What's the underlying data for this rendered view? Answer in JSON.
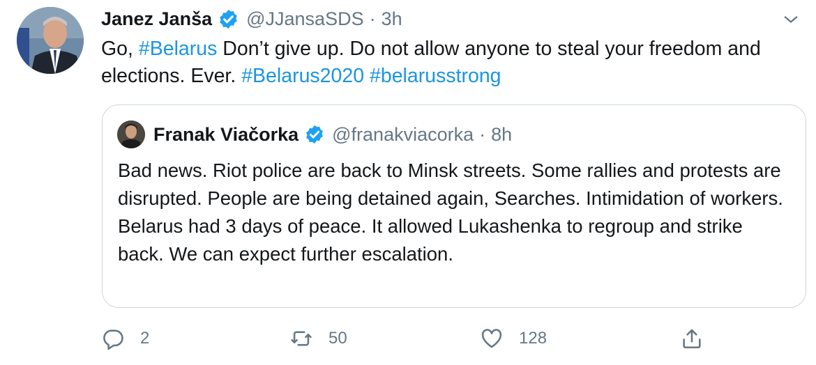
{
  "tweet": {
    "author": {
      "display_name": "Janez Janša",
      "handle": "@JJansaSDS",
      "separator": "·",
      "time": "3h",
      "verified_icon": "verified-badge-icon"
    },
    "text": {
      "part1": "Go, ",
      "hashtag1": "#Belarus",
      "part2": " Don’t give up. Do not allow anyone to steal your freedom and elections. Ever. ",
      "hashtag2": "#Belarus2020",
      "space": " ",
      "hashtag3": "#belarusstrong"
    },
    "menu_icon": "chevron-down-icon"
  },
  "quoted_tweet": {
    "author": {
      "display_name": "Franak Viačorka",
      "handle": "@franakviacorka",
      "separator": "·",
      "time": "8h",
      "verified_icon": "verified-badge-icon"
    },
    "text": "Bad news. Riot police are back to Minsk streets. Some rallies and protests are disrupted. People are being detained again, Searches. Intimidation of workers. Belarus had 3 days of peace. It allowed Lukashenka to regroup and strike back. We can expect further escalation."
  },
  "actions": {
    "reply": {
      "icon": "reply-icon",
      "count": "2"
    },
    "retweet": {
      "icon": "retweet-icon",
      "count": "50"
    },
    "like": {
      "icon": "heart-icon",
      "count": "128"
    },
    "share": {
      "icon": "share-icon"
    }
  },
  "colors": {
    "link": "#1b95e0",
    "secondary_text": "#657786",
    "verified": "#1da1f2",
    "border": "#ccd6dd"
  }
}
